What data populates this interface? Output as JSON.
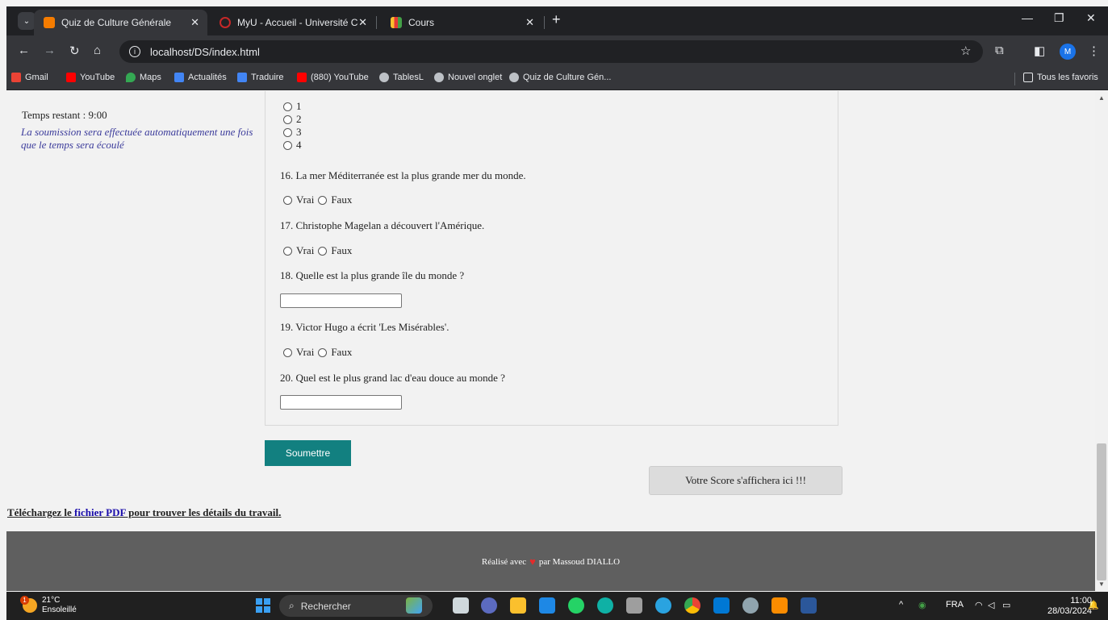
{
  "browser": {
    "tabs": [
      {
        "title": "Quiz de Culture Générale",
        "color": "#f57c00",
        "active": true
      },
      {
        "title": "MyU - Accueil - Université Cent",
        "color": "#c62828",
        "active": false
      },
      {
        "title": "Cours",
        "color": "#fbc02d",
        "active": false
      }
    ],
    "url": "localhost/DS/index.html",
    "avatar": "M",
    "bookmarks": [
      {
        "label": "Gmail",
        "color": "#ea4335"
      },
      {
        "label": "YouTube",
        "color": "#ff0000"
      },
      {
        "label": "Maps",
        "color": "#34a853"
      },
      {
        "label": "Actualités",
        "color": "#4285f4"
      },
      {
        "label": "Traduire",
        "color": "#4285f4"
      },
      {
        "label": "(880) YouTube",
        "color": "#ff0000"
      },
      {
        "label": "TablesL",
        "color": "#bdc1c6"
      },
      {
        "label": "Nouvel onglet",
        "color": "#bdc1c6"
      },
      {
        "label": "Quiz de Culture Gén...",
        "color": "#bdc1c6"
      }
    ],
    "all_bookmarks": "Tous les favoris"
  },
  "page": {
    "timer": "Temps restant : 9:00",
    "note": "La soumission sera effectuée automatiquement une fois que le temps sera écoulé",
    "prev_options": [
      "1",
      "2",
      "3",
      "4"
    ],
    "vrai": "Vrai",
    "faux": "Faux",
    "q16": "16. La mer Méditerranée est la plus grande mer du monde.",
    "q17": "17. Christophe Magelan a découvert l'Amérique.",
    "q18": "18. Quelle est la plus grande île du monde ?",
    "q19": "19. Victor Hugo a écrit 'Les Misérables'.",
    "q20": "20. Quel est le plus grand lac d'eau douce au monde ?",
    "submit": "Soumettre",
    "score": "Votre Score s'affichera ici !!!",
    "download_pre": "Téléchargez le ",
    "download_link": "fichier PDF",
    "download_post": " pour trouver les détails du travail.",
    "footer_pre": "Réalisé avec",
    "footer_post": "par Massoud DIALLO"
  },
  "taskbar": {
    "temp": "21°C",
    "weather": "Ensoleillé",
    "weather_badge": "1",
    "search": "Rechercher",
    "lang": "FRA",
    "time": "11:00",
    "date": "28/03/2024"
  }
}
